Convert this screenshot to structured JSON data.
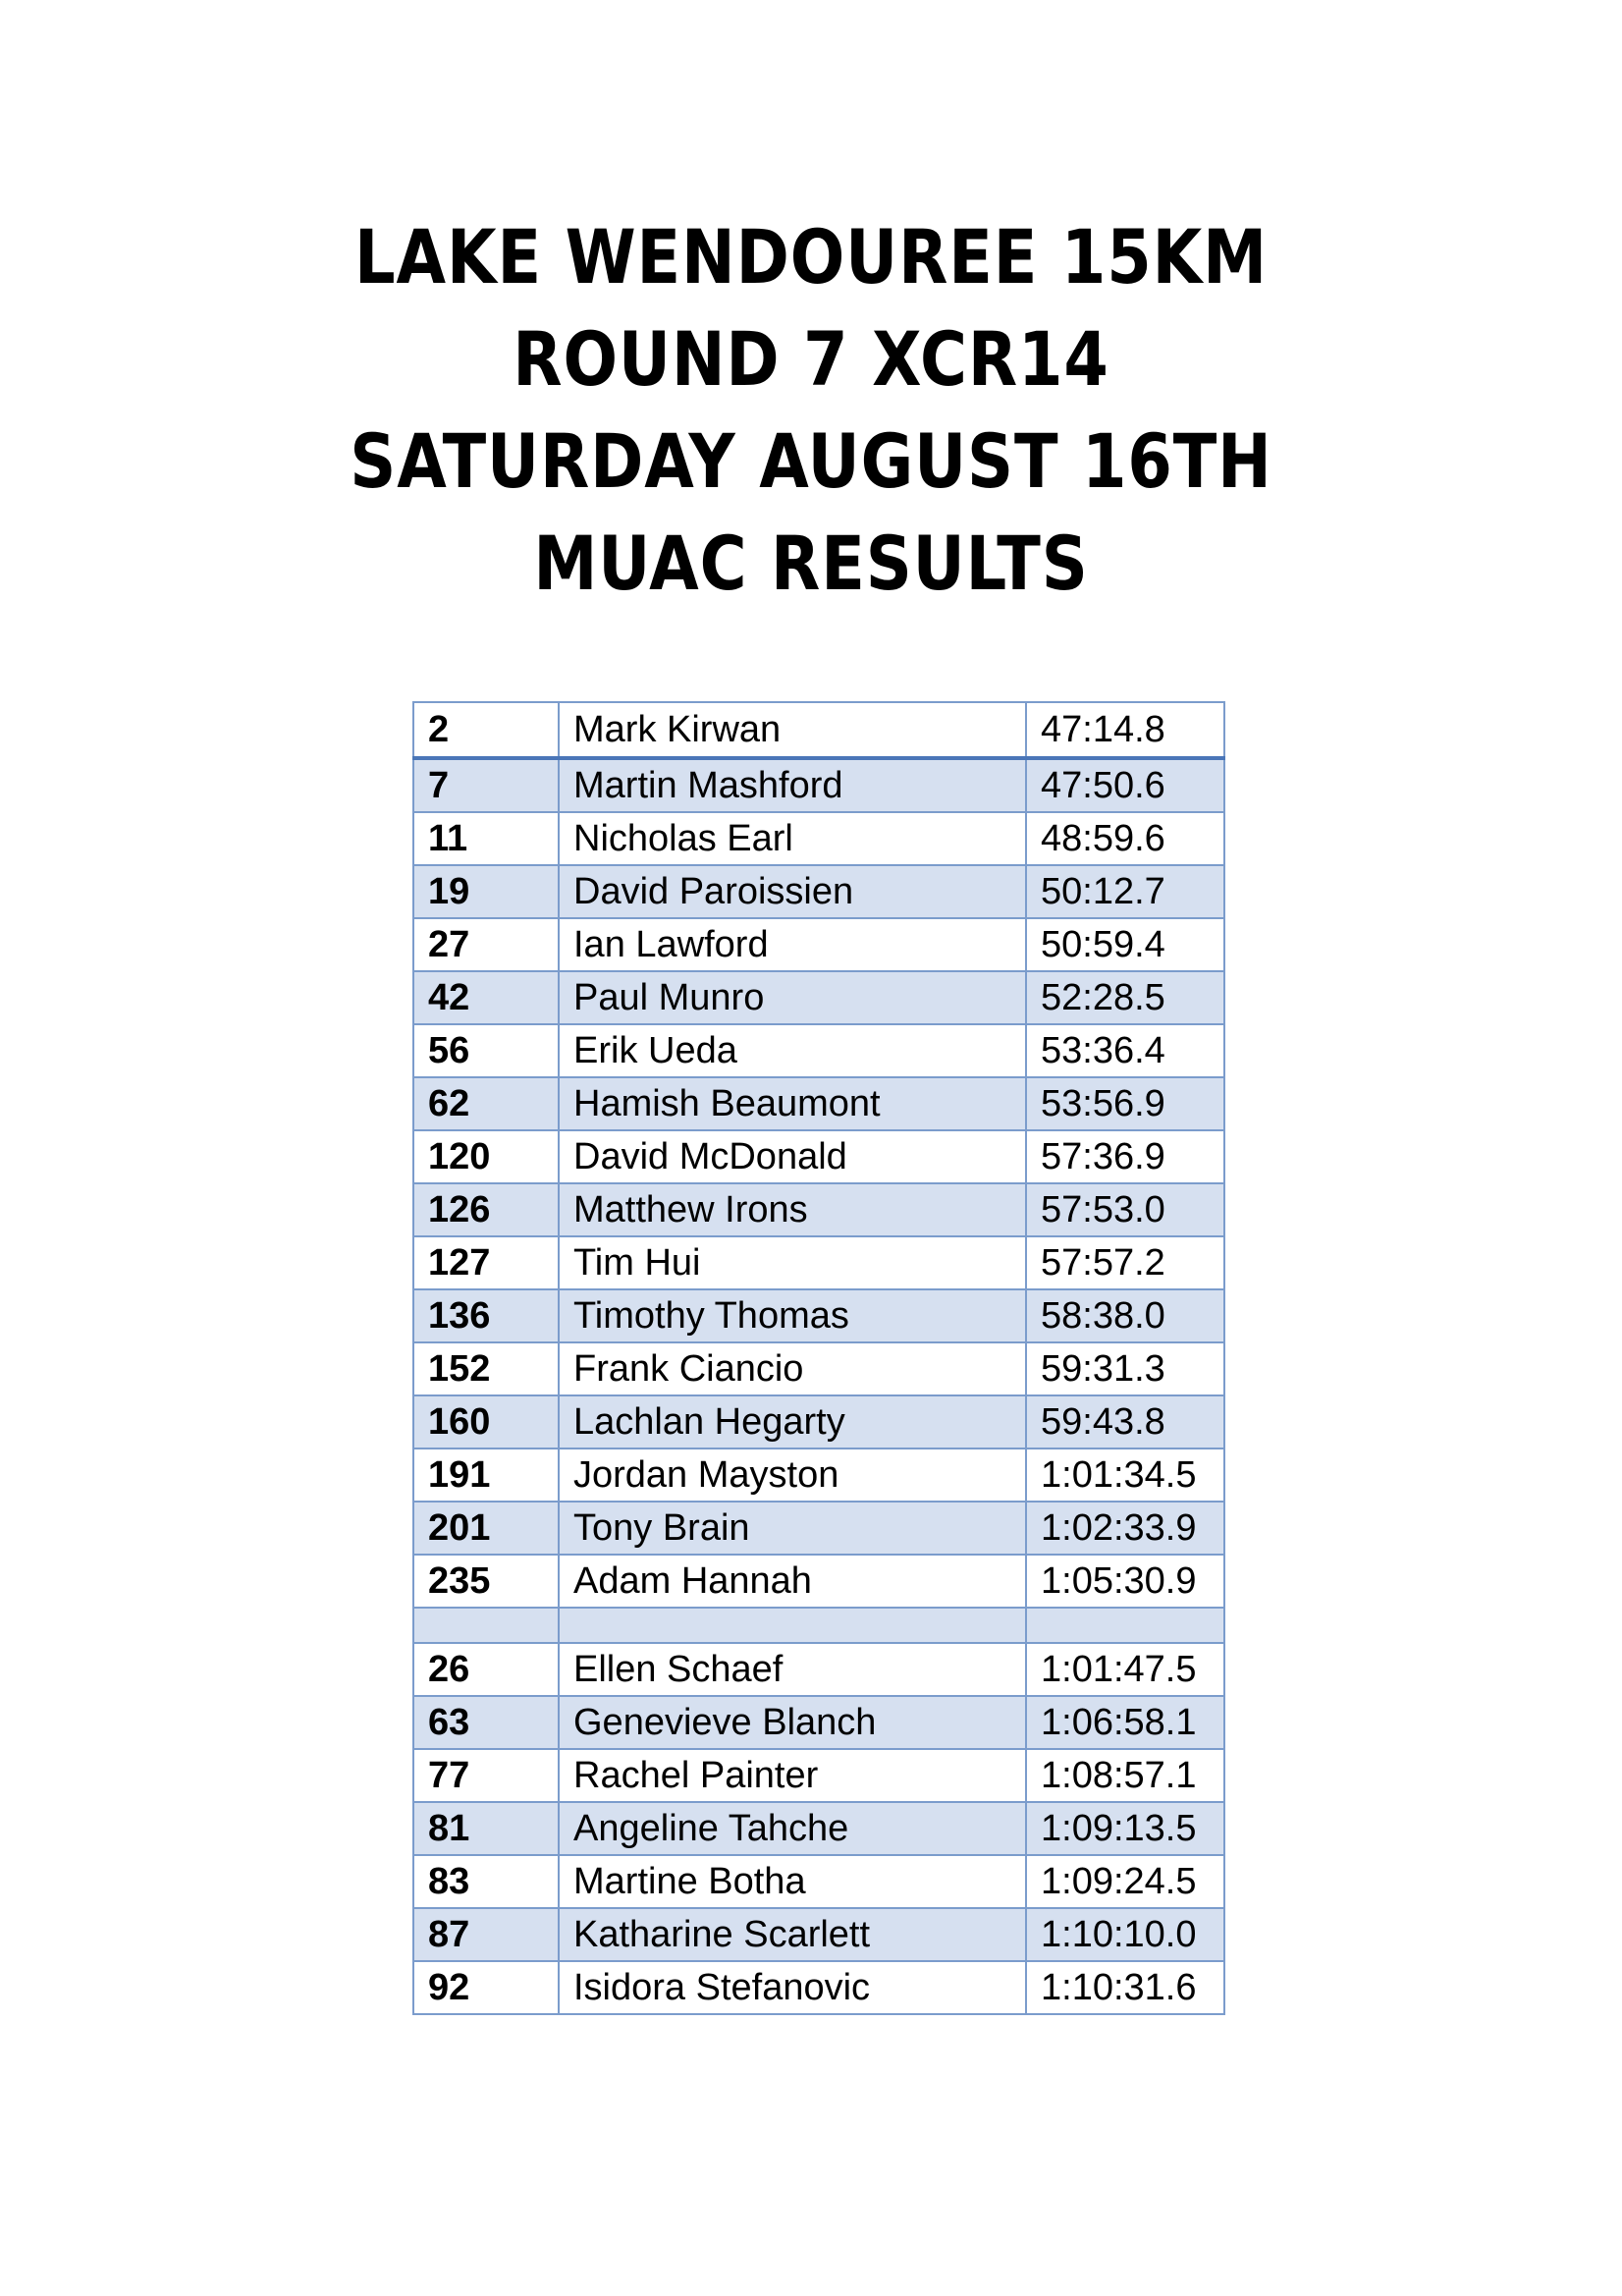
{
  "title": {
    "line1": "LAKE WENDOUREE 15KM",
    "line2": "ROUND 7 XCR14",
    "line3": "SATURDAY AUGUST 16TH",
    "line4": "MUAC RESULTS"
  },
  "results": {
    "top_row": {
      "place": "2",
      "name": "Mark Kirwan",
      "time": "47:14.8"
    },
    "men": [
      {
        "place": "7",
        "name": "Martin Mashford",
        "time": "47:50.6"
      },
      {
        "place": "11",
        "name": "Nicholas Earl",
        "time": "48:59.6"
      },
      {
        "place": "19",
        "name": "David Paroissien",
        "time": "50:12.7"
      },
      {
        "place": "27",
        "name": "Ian Lawford",
        "time": "50:59.4"
      },
      {
        "place": "42",
        "name": "Paul Munro",
        "time": "52:28.5"
      },
      {
        "place": "56",
        "name": "Erik Ueda",
        "time": "53:36.4"
      },
      {
        "place": "62",
        "name": "Hamish Beaumont",
        "time": "53:56.9"
      },
      {
        "place": "120",
        "name": "David McDonald",
        "time": "57:36.9"
      },
      {
        "place": "126",
        "name": "Matthew Irons",
        "time": "57:53.0"
      },
      {
        "place": "127",
        "name": "Tim Hui",
        "time": "57:57.2"
      },
      {
        "place": "136",
        "name": "Timothy Thomas",
        "time": "58:38.0"
      },
      {
        "place": "152",
        "name": "Frank Ciancio",
        "time": "59:31.3"
      },
      {
        "place": "160",
        "name": "Lachlan Hegarty",
        "time": "59:43.8"
      },
      {
        "place": "191",
        "name": "Jordan Mayston",
        "time": "1:01:34.5"
      },
      {
        "place": "201",
        "name": "Tony Brain",
        "time": "1:02:33.9"
      },
      {
        "place": "235",
        "name": "Adam Hannah",
        "time": "1:05:30.9"
      }
    ],
    "women": [
      {
        "place": "26",
        "name": "Ellen Schaef",
        "time": "1:01:47.5"
      },
      {
        "place": "63",
        "name": "Genevieve Blanch",
        "time": "1:06:58.1"
      },
      {
        "place": "77",
        "name": "Rachel Painter",
        "time": "1:08:57.1"
      },
      {
        "place": "81",
        "name": "Angeline Tahche",
        "time": "1:09:13.5"
      },
      {
        "place": "83",
        "name": "Martine Botha",
        "time": "1:09:24.5"
      },
      {
        "place": "87",
        "name": "Katharine Scarlett",
        "time": "1:10:10.0"
      },
      {
        "place": "92",
        "name": "Isidora Stefanovic",
        "time": "1:10:31.6"
      }
    ]
  },
  "colors": {
    "border": "#7b9ccc",
    "header_rule": "#4a76b8",
    "band_shade": "#d6e0f0"
  }
}
